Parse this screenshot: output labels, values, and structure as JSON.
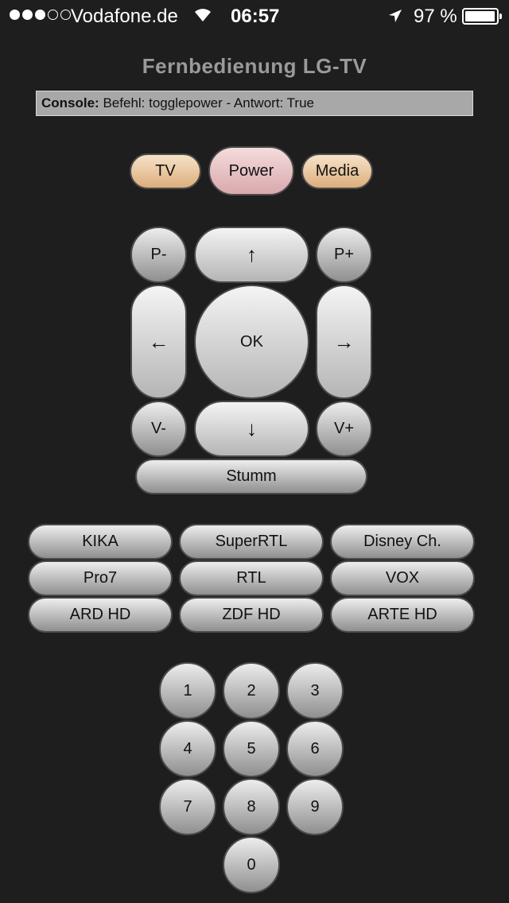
{
  "status_bar": {
    "carrier": "Vodafone.de",
    "time": "06:57",
    "battery": "97 %",
    "battery_level": 0.97,
    "signal_bars": 3,
    "icons": [
      "signal-dots-icon",
      "wifi-icon",
      "location-arrow-icon",
      "battery-icon"
    ]
  },
  "header": {
    "title": "Fernbedienung LG-TV",
    "console_label": "Console:",
    "console_text": "Befehl: togglepower - Antwort: True"
  },
  "mode_buttons": {
    "tv": "TV",
    "power": "Power",
    "media": "Media"
  },
  "nav": {
    "program_down": "P-",
    "up": "↑",
    "program_up": "P+",
    "left": "←",
    "ok": "OK",
    "right": "→",
    "volume_down": "V-",
    "down": "↓",
    "volume_up": "V+",
    "mute": "Stumm"
  },
  "channels": [
    "KIKA",
    "SuperRTL",
    "Disney Ch.",
    "Pro7",
    "RTL",
    "VOX",
    "ARD HD",
    "ZDF HD",
    "ARTE HD"
  ],
  "keypad": [
    "1",
    "2",
    "3",
    "4",
    "5",
    "6",
    "7",
    "8",
    "9",
    "0"
  ],
  "colors": {
    "background": "#1e1e1e",
    "title": "#9a9a9a",
    "console_bg": "#a8a8a8",
    "orange_button": "#e7c39a",
    "pink_button": "#e6c0c3"
  }
}
